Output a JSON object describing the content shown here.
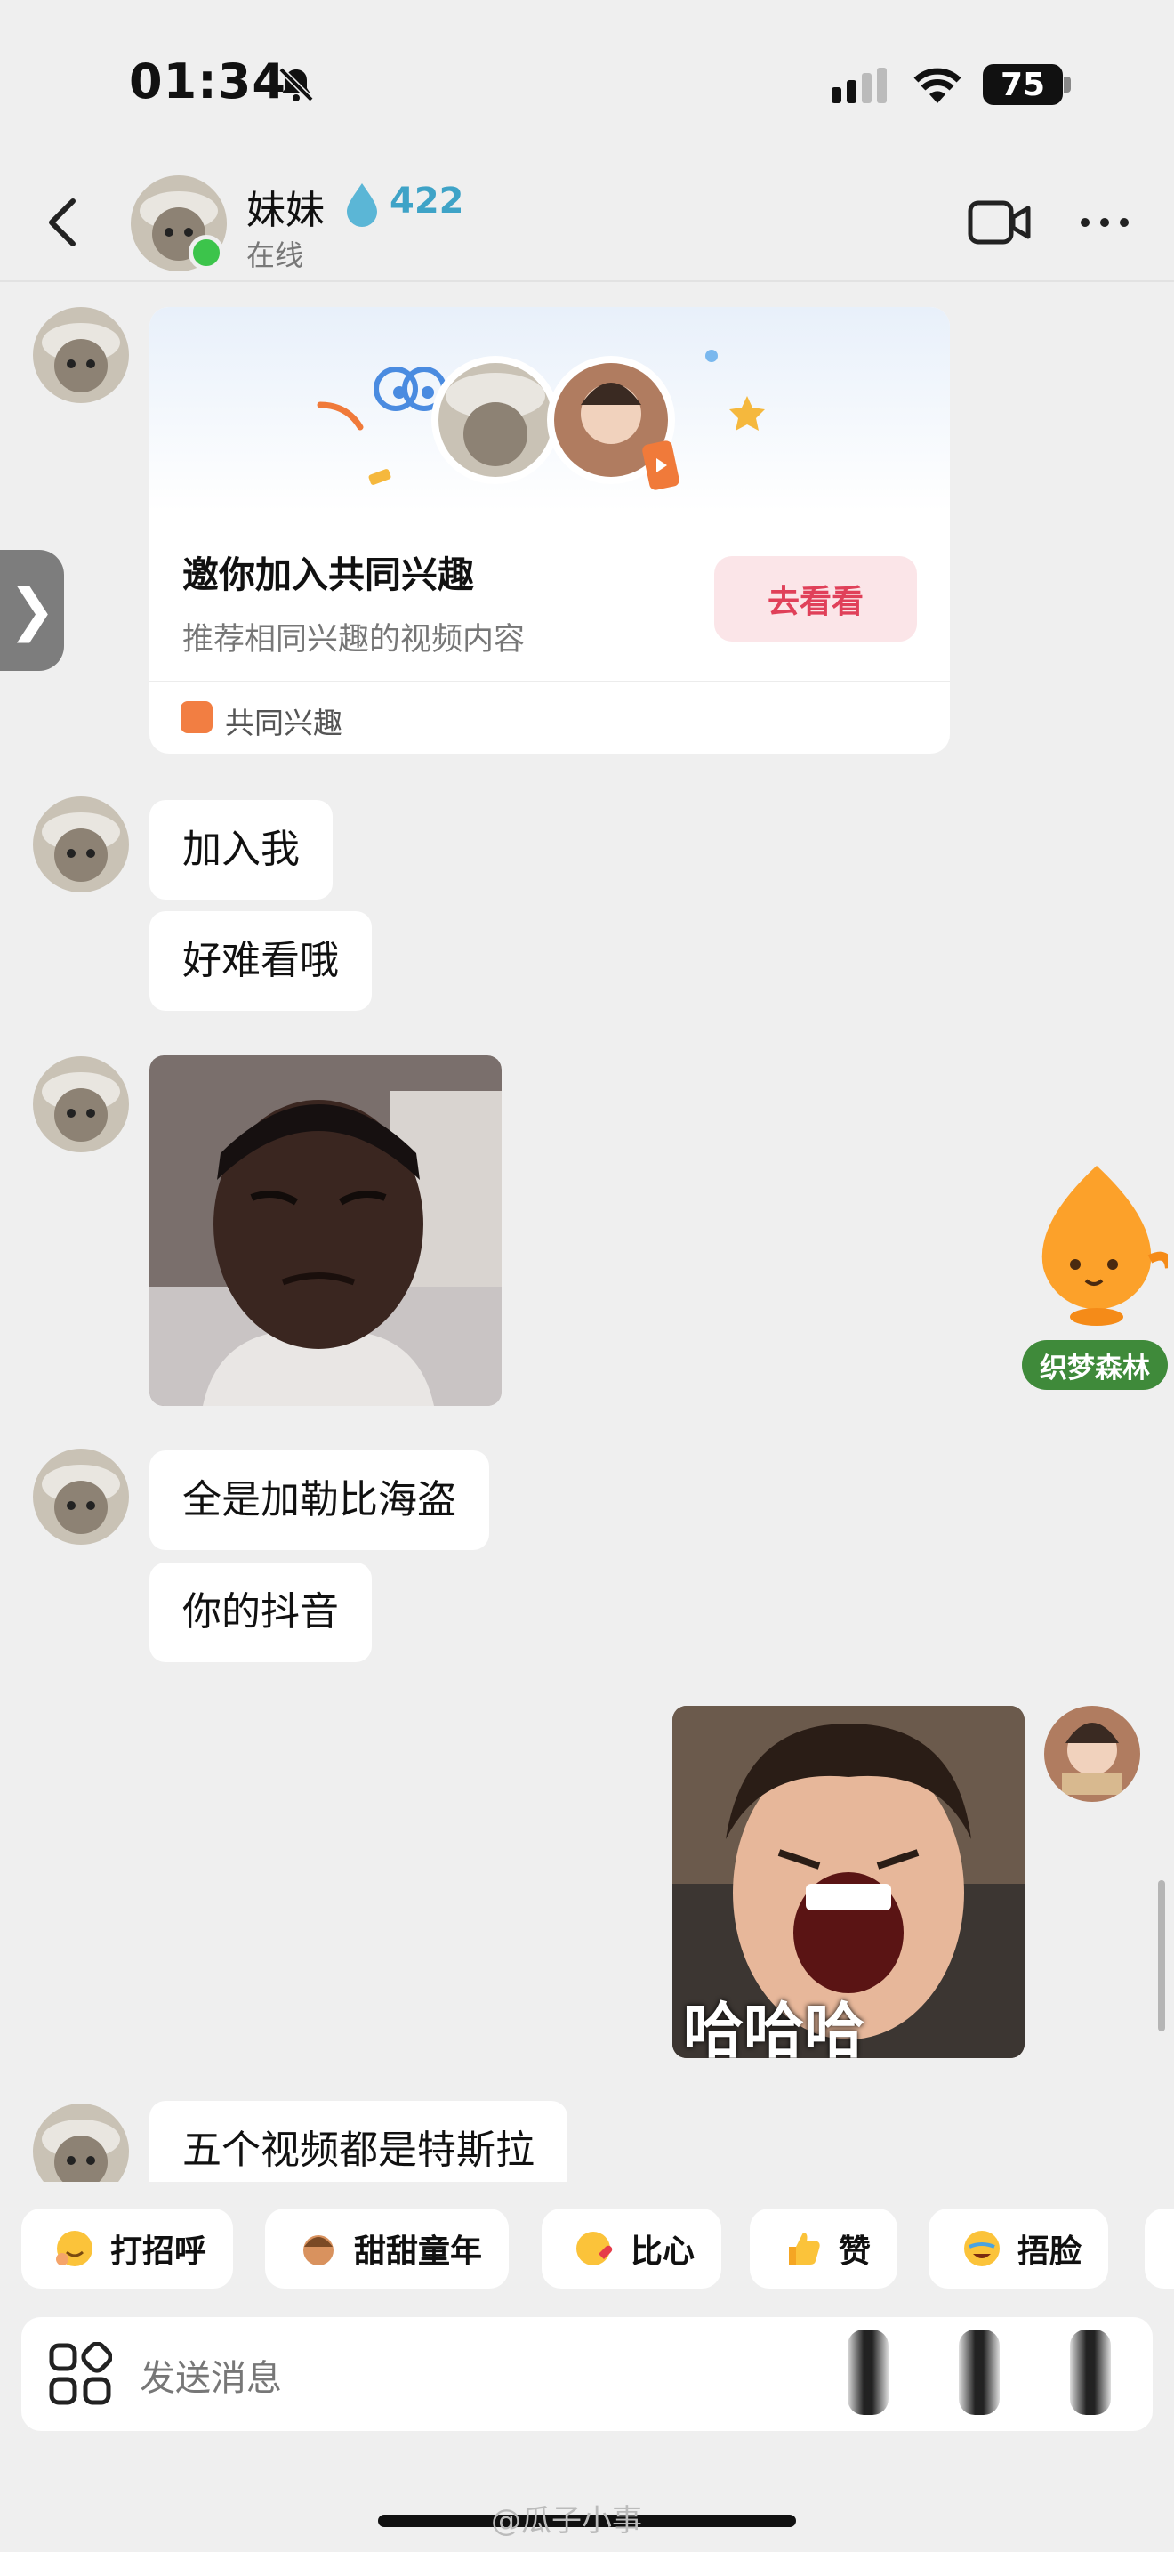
{
  "status_bar": {
    "time": "01:34",
    "battery": "75"
  },
  "header": {
    "contact_name": "妹妹",
    "streak_count": "422",
    "presence": "在线"
  },
  "interest_card": {
    "title": "邀你加入共同兴趣",
    "subtitle": "推荐相同兴趣的视频内容",
    "button_label": "去看看",
    "footer_label": "共同兴趣"
  },
  "messages": [
    {
      "from": "them",
      "text": "加入我"
    },
    {
      "from": "them",
      "text": "好难看哦"
    },
    {
      "from": "them",
      "text": "全是加勒比海盗"
    },
    {
      "from": "them",
      "text": "你的抖音"
    },
    {
      "from": "me",
      "sticker_caption": "哈哈哈"
    },
    {
      "from": "them",
      "text": "五个视频都是特斯拉"
    }
  ],
  "floating_widget": {
    "label": "织梦森林"
  },
  "quick_replies": [
    {
      "label": "打招呼",
      "icon": "smile-wave-emoji"
    },
    {
      "label": "甜甜童年",
      "icon": "child-emoji"
    },
    {
      "label": "比心",
      "icon": "heart-hands-emoji"
    },
    {
      "label": "赞",
      "icon": "thumbs-up-emoji"
    },
    {
      "label": "捂脸",
      "icon": "facepalm-emoji"
    }
  ],
  "input": {
    "placeholder": "发送消息"
  },
  "watermark": "@瓜子小事",
  "colors": {
    "accent_red": "#e04059",
    "online_green": "#3cc44b",
    "streak_blue": "#3ea3c7"
  }
}
